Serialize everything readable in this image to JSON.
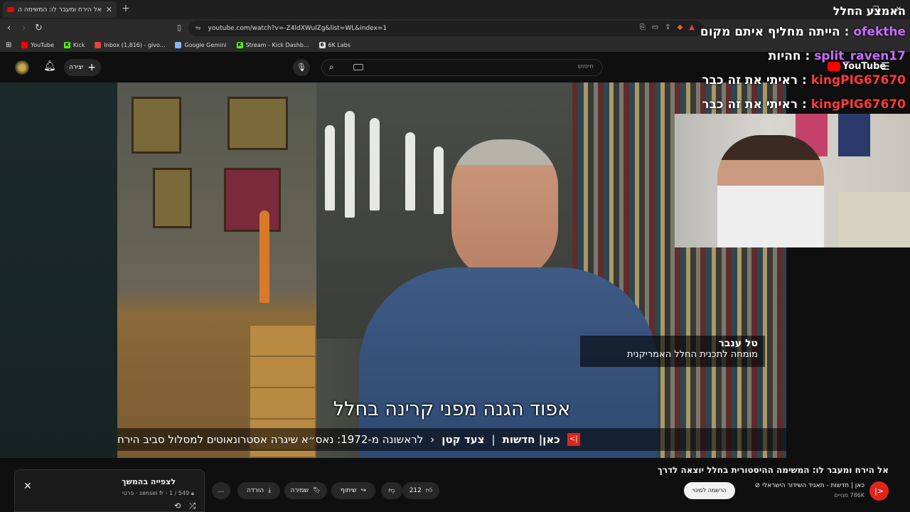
{
  "browser": {
    "tab_title": "אל הירח ומעבר לו: המשימה ה",
    "new_tab": "+",
    "window_controls": [
      "—",
      "❐",
      "✕"
    ],
    "url": "youtube.com/watch?v=-Z4ldXWulZg&list=WL&index=1",
    "bookmarks": [
      {
        "label": "YouTube",
        "icon": "youtube-icon",
        "color": "#ff0000"
      },
      {
        "label": "Kick",
        "icon": "kick-icon",
        "color": "#53fc18"
      },
      {
        "label": "Inbox (1,816) - givo...",
        "icon": "gmail-icon",
        "color": "#ea4335"
      },
      {
        "label": "Google Gemini",
        "icon": "gemini-icon",
        "color": "#8ab4f8"
      },
      {
        "label": "Stream - Kick Dashb...",
        "icon": "kick-icon",
        "color": "#53fc18"
      },
      {
        "label": "6K Labs",
        "icon": "6k-icon",
        "color": "#dddddd"
      }
    ]
  },
  "youtube_header": {
    "create_label": "יצירה",
    "search_placeholder": "חיפוש"
  },
  "chat_overlay": {
    "title": "האמצע החלל",
    "lines": [
      {
        "user": "ofekthe",
        "message": "הייתה מחליף איתם מקום",
        "color": "#c96bff"
      },
      {
        "user": "split_raven17",
        "message": "חהיות",
        "color": "#c96bff"
      },
      {
        "user": "kingPIG67670",
        "message": "ראיתי את זה כבר",
        "color": "#ff3b3b"
      },
      {
        "user": "kingPIG67670",
        "message": "ראיתי את זה כבר",
        "color": "#ff3b3b"
      }
    ],
    "youtube_logo": "YouTube"
  },
  "video": {
    "lower_third_name": "טל ענבר",
    "lower_third_title": "מומחה לתכנית החלל האמריקנית",
    "subtitle": "אפוד הגנה מפני קרינה בחלל",
    "ticker_brand": "כאן| חדשות",
    "ticker_separator": "|",
    "ticker_section": "צעד קטן",
    "ticker_text": "לראשונה מ-1972: נאס״א שיגרה אסטרונאוטים למסלול סביב הירח"
  },
  "watch": {
    "title": "אל הירח ומעבר לו: המשימה ההיסטורית בחלל יוצאה לדרך",
    "channel_name": "כאן | חדשות - תאגיד השידור הישראלי",
    "subscribers": "786K מנויים",
    "subscribe_label": "הרשמה למינוי",
    "like_count": "212",
    "share_label": "שיתוף",
    "save_label": "שמירה",
    "download_label": "הורדה",
    "more_label": "..."
  },
  "playlist": {
    "title": "לצפייה בהמשך",
    "subtitle": "פרטי · sensei fr - 1 / 549"
  }
}
